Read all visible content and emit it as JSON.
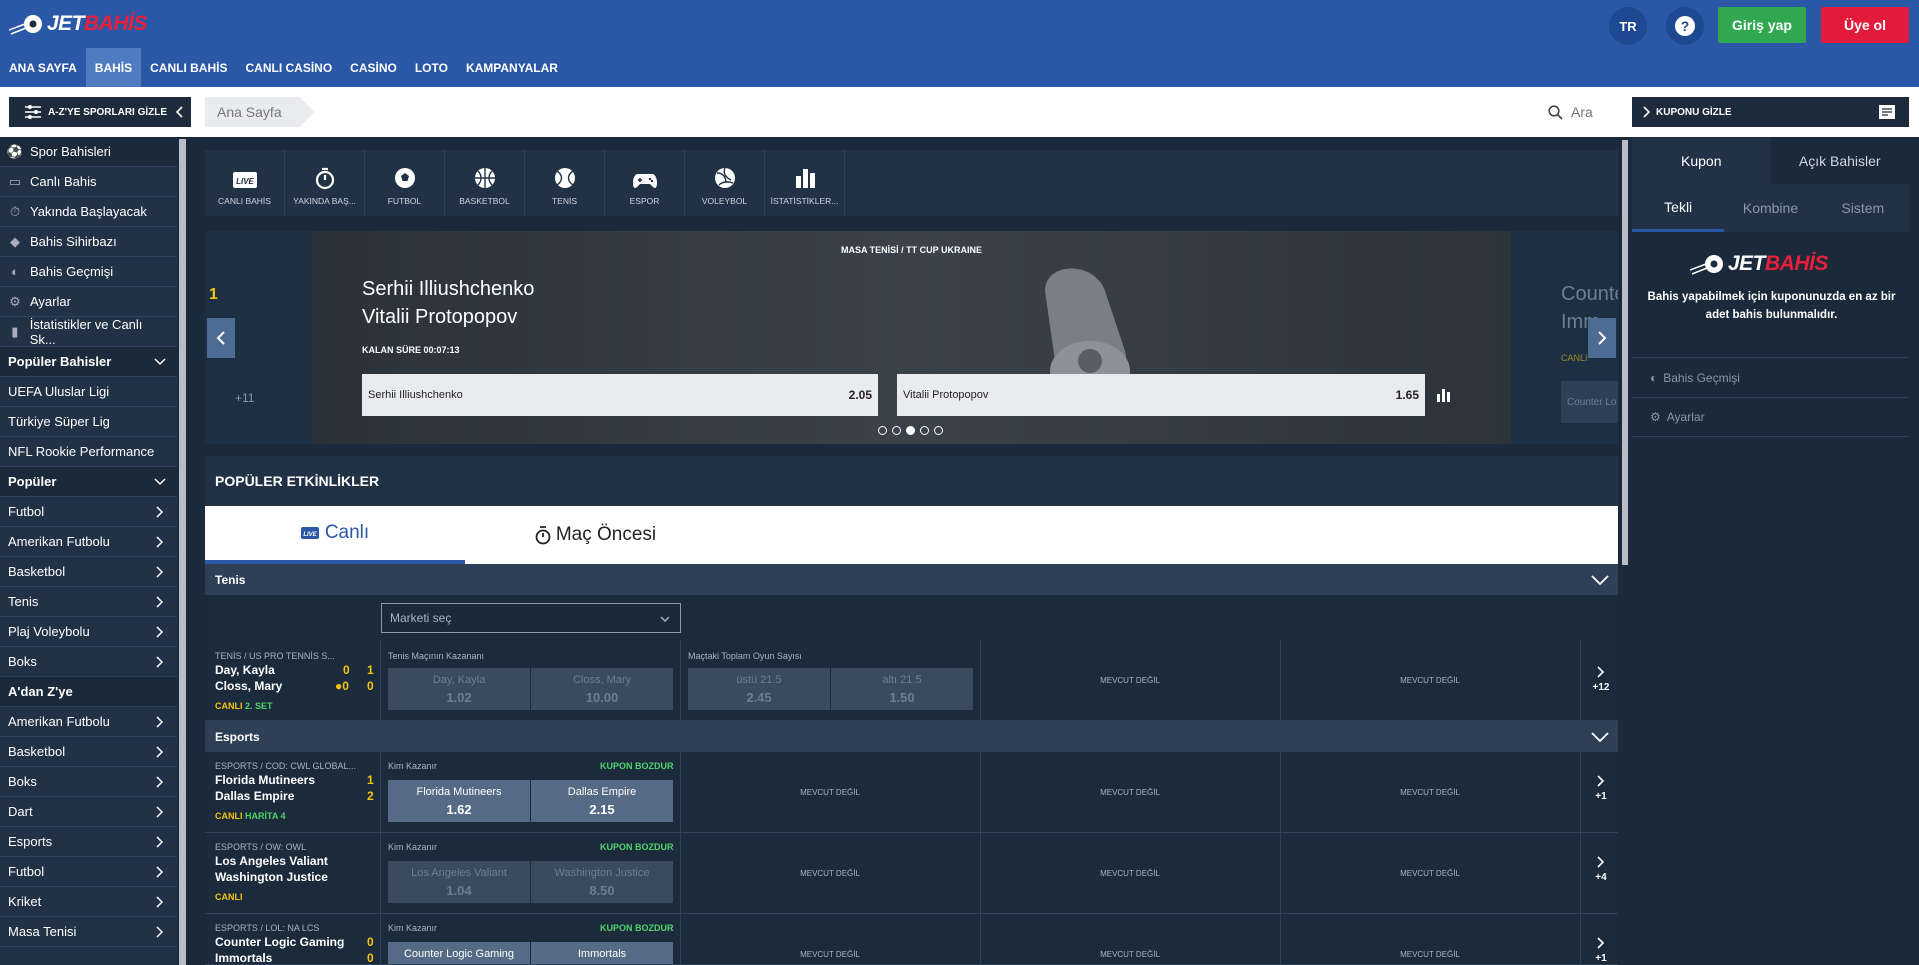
{
  "header": {
    "logo_jet": "JET",
    "logo_bahis": "BAHİS",
    "lang": "TR",
    "help": "?",
    "login": "Giriş yap",
    "register": "Üye ol"
  },
  "nav": [
    "ANA SAYFA",
    "BAHİS",
    "CANLI BAHİS",
    "CANLI CASİNO",
    "CASİNO",
    "LOTO",
    "KAMPANYALAR"
  ],
  "toolbar": {
    "hide_sports": "A-Z'YE SPORLARI GİZLE",
    "breadcrumb": "Ana Sayfa",
    "search_placeholder": "Ara",
    "hide_coupon": "KUPONU GİZLE"
  },
  "sidebar": {
    "menu": [
      "Spor Bahisleri",
      "Canlı Bahis",
      "Yakında Başlayacak",
      "Bahis Sihirbazı",
      "Bahis Geçmişi",
      "Ayarlar",
      "İstatistikler ve Canlı Sk..."
    ],
    "popular_bets_header": "Popüler Bahisler",
    "popular_bets": [
      "UEFA Uluslar Ligi",
      "Türkiye Süper Lig",
      "NFL Rookie Performance"
    ],
    "popular_header": "Popüler",
    "popular": [
      "Futbol",
      "Amerikan Futbolu",
      "Basketbol",
      "Tenis",
      "Plaj Voleybolu",
      "Boks"
    ],
    "az_header": "A'dan Z'ye",
    "az": [
      "Amerikan Futbolu",
      "Basketbol",
      "Boks",
      "Dart",
      "Esports",
      "Futbol",
      "Kriket",
      "Masa Tenisi"
    ]
  },
  "sports_bar": [
    "CANLI BAHİS",
    "YAKINDA BAŞ...",
    "FUTBOL",
    "BASKETBOL",
    "TENİS",
    "ESPOR",
    "VOLEYBOL",
    "İSTATİSTİKLER..."
  ],
  "banner": {
    "category": "MASA TENİSİ / TT CUP UKRAINE",
    "player1": "Serhii Illiushchenko",
    "player2": "Vitalii Protopopov",
    "time": "KALAN SÜRE 00:07:13",
    "odd1_name": "Serhii Illiushchenko",
    "odd1": "2.05",
    "odd2_name": "Vitalii Protopopov",
    "odd2": "1.65",
    "left_peek_score": "1",
    "left_peek_more": "+11",
    "right_peek_1": "Counte",
    "right_peek_2": "Imm",
    "right_peek_live": "CANLI",
    "right_peek_btn": "Counter Lo"
  },
  "popular_events": {
    "title": "POPÜLER ETKİNLİKLER",
    "tab_live": "Canlı",
    "tab_pre": "Maç Öncesi"
  },
  "tennis": {
    "category": "Tenis",
    "market_select": "Marketi seç",
    "league": "TENİS / US PRO TENNİS S...",
    "team1": "Day, Kayla",
    "team2": "Closs, Mary",
    "s1a": "0",
    "s1b": "1",
    "s2a": "●0",
    "s2b": "0",
    "live": "CANLI",
    "period": "2. SET",
    "m1_title": "Tenis Maçının Kazananı",
    "m1_o1": "Day, Kayla",
    "m1_v1": "1.02",
    "m1_o2": "Closs, Mary",
    "m1_v2": "10.00",
    "m2_title": "Maçtaki Toplam Oyun Sayısı",
    "m2_o1": "üstü 21.5",
    "m2_v1": "2.45",
    "m2_o2": "altı 21.5",
    "m2_v2": "1.50",
    "na": "MEVCUT DEĞİL",
    "more": "+12"
  },
  "esports": {
    "category": "Esports",
    "na": "MEVCUT DEĞİL",
    "market": "Kim Kazanır",
    "kupon": "KUPON BOZDUR",
    "rows": [
      {
        "league": "ESPORTS / COD: CWL GLOBAL...",
        "team1": "Florida Mutineers",
        "team2": "Dallas Empire",
        "s1": "1",
        "s2": "2",
        "live": "CANLI",
        "period": "HARİTA 4",
        "v1": "1.62",
        "v2": "2.15",
        "more": "+1"
      },
      {
        "league": "ESPORTS / OW: OWL",
        "team1": "Los Angeles Valiant",
        "team2": "Washington Justice",
        "s1": "",
        "s2": "",
        "live": "CANLI",
        "period": "",
        "v1": "1.04",
        "v2": "8.50",
        "more": "+4"
      },
      {
        "league": "ESPORTS / LOL: NA LCS",
        "team1": "Counter Logic Gaming",
        "team2": "Immortals",
        "s1": "0",
        "s2": "0",
        "live": "",
        "period": "",
        "v1": "",
        "v2": "",
        "more": "+1"
      }
    ]
  },
  "rpanel": {
    "tab1": "Kupon",
    "tab2": "Açık Bahisler",
    "sub1": "Tekli",
    "sub2": "Kombine",
    "sub3": "Sistem",
    "msg": "Bahis yapabilmek için kuponunuzda en az bir adet bahis bulunmalıdır.",
    "link1": "Bahis Geçmişi",
    "link2": "Ayarlar"
  },
  "colors": {
    "header": "#2b58a6",
    "login": "#2fa84f",
    "register": "#e31b3b",
    "live": "#f1c40f",
    "kupon": "#4fd36b"
  }
}
